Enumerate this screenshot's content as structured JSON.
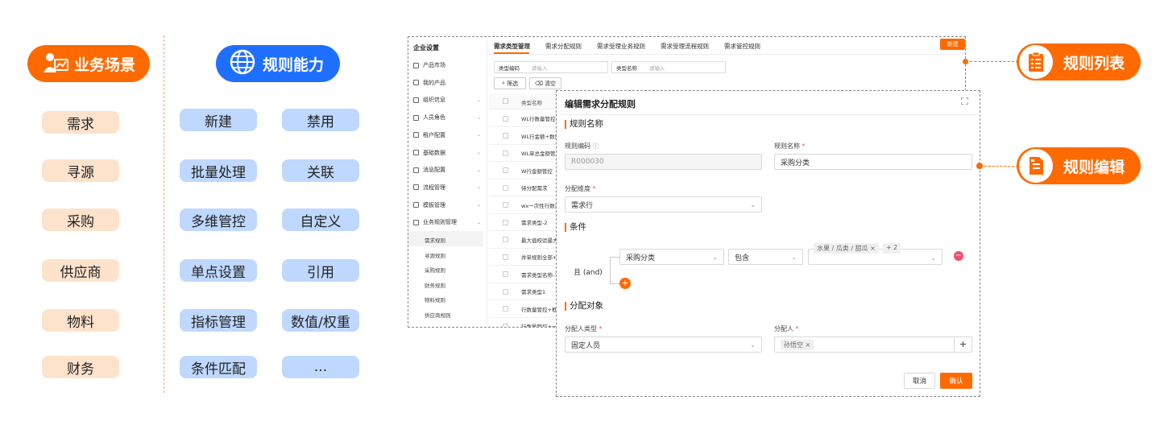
{
  "left": {
    "scene_title": "业务场景",
    "scenes": [
      "需求",
      "寻源",
      "采购",
      "供应商",
      "物料",
      "财务"
    ],
    "cap_title": "规则能力",
    "caps": [
      "新建",
      "禁用",
      "批量处理",
      "关联",
      "多维管控",
      "自定义",
      "单点设置",
      "引用",
      "指标管理",
      "数值/权重",
      "条件匹配",
      "..."
    ]
  },
  "right": {
    "list": "规则列表",
    "edit": "规则编辑"
  },
  "shot": {
    "title": "企业设置",
    "tabs": [
      "需求类型管理",
      "需求分配规则",
      "需求受理业务规则",
      "需求受理流程规则",
      "需求管控规则"
    ],
    "new_btn": "新建",
    "menu": [
      {
        "label": "产品市场",
        "chev": false
      },
      {
        "label": "我的产品",
        "chev": false
      },
      {
        "label": "组织信息",
        "chev": true
      },
      {
        "label": "人员角色",
        "chev": true
      },
      {
        "label": "租户配置",
        "chev": true
      },
      {
        "label": "基础数据",
        "chev": true
      },
      {
        "label": "消息配置",
        "chev": true
      },
      {
        "label": "流程管理",
        "chev": true
      },
      {
        "label": "模板管理",
        "chev": true
      },
      {
        "label": "业务规则管理",
        "chev": true
      }
    ],
    "submenu": [
      "需求规则",
      "寻源规则",
      "采购规则",
      "财务规则",
      "物料规则",
      "供应商规则"
    ],
    "filter": {
      "code_label": "类型编码",
      "code_ph": "请输入",
      "name_label": "类型名称",
      "name_ph": "请输入",
      "filter_btn": "筛选",
      "clear_btn": "清空"
    },
    "col": "类型名称",
    "rows": [
      "WL行数量管控",
      "WL行金额+数量管控",
      "WL单总金额管控",
      "W行金额管控",
      "待分配需求",
      "wx一次性行数量管控",
      "需求类型-2",
      "最大值校验最大值",
      "并单规则全部+框",
      "需求类型名称-1",
      "需求类型1",
      "行数量管控+框架",
      "行数量管控+一次"
    ]
  },
  "modal": {
    "title": "编辑需求分配规则",
    "sec1": "规则名称",
    "code_label": "规则编码",
    "code_value": "R000030",
    "name_label": "规则名称",
    "name_value": "采购分类",
    "dim_label": "分配维度",
    "dim_value": "需求行",
    "sec2": "条件",
    "and_label": "且 (and)",
    "cond_field": "采购分类",
    "cond_op": "包含",
    "cond_tag": "水果 / 瓜类 / 甜瓜",
    "cond_more": "+ 2",
    "sec3": "分配对象",
    "type_label": "分配人类型",
    "type_value": "固定人员",
    "person_label": "分配人",
    "person_tag": "孙悟空",
    "cancel": "取消",
    "ok": "确认"
  },
  "colors": {
    "orange": "#ff6a00",
    "blue": "#1f6fff",
    "scene_bg": "#fde3cc",
    "cap_bg": "#bfd8ff"
  }
}
